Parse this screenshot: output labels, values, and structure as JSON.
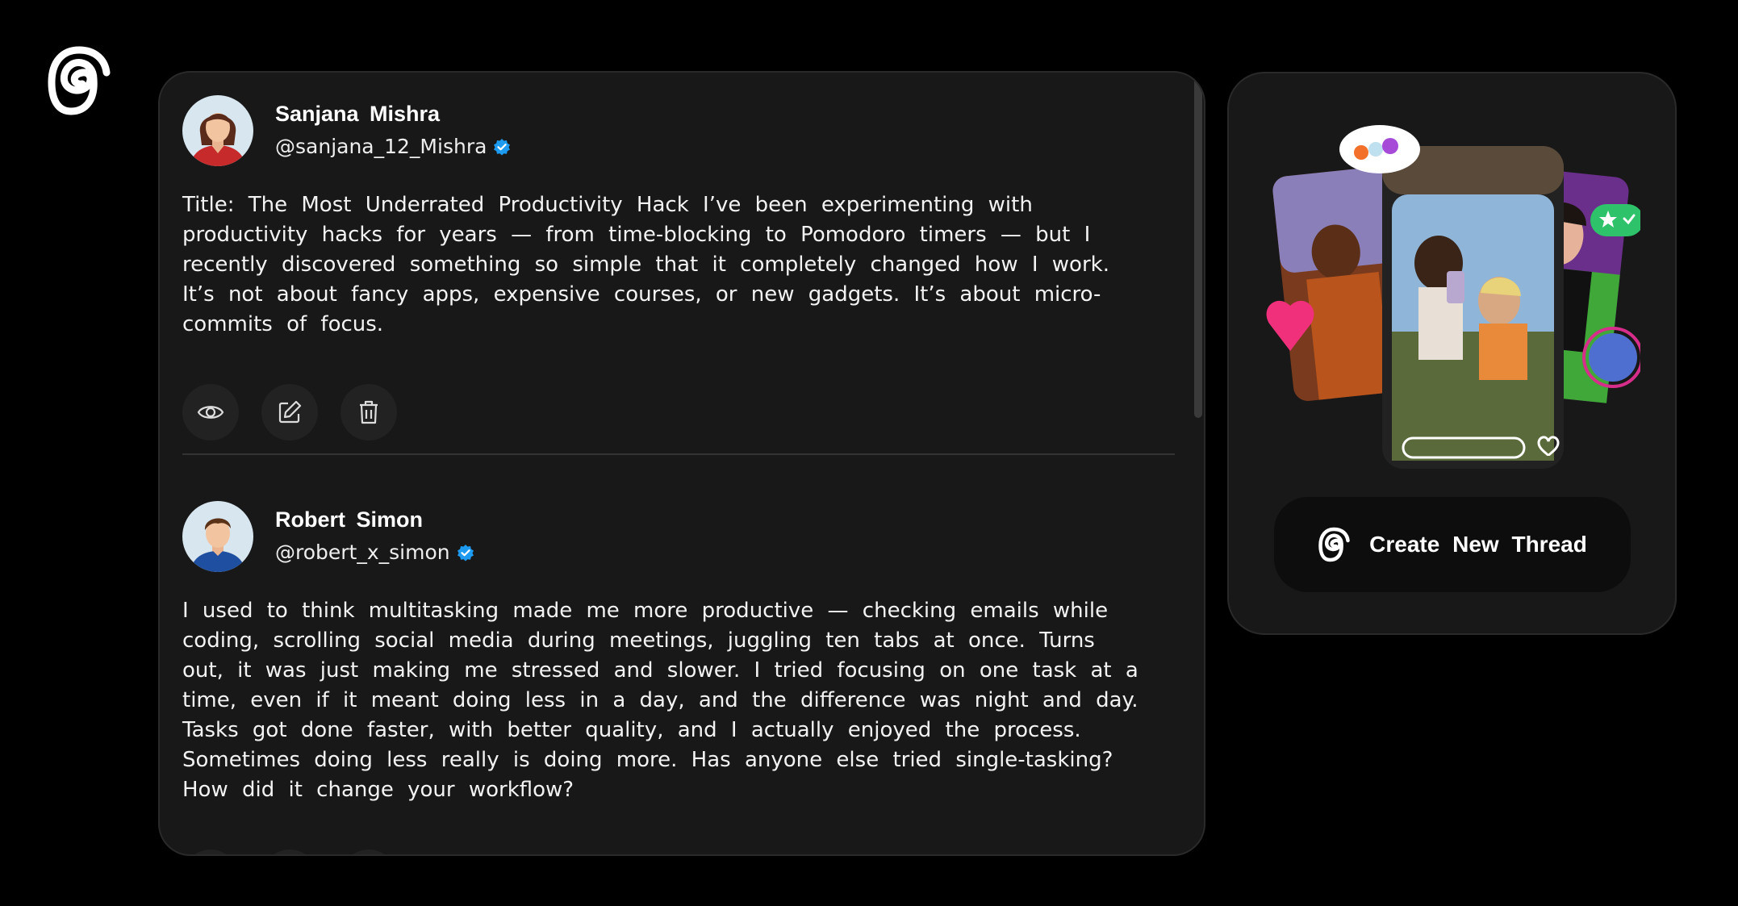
{
  "app": {
    "logo_icon": "threads-logo-icon"
  },
  "posts": [
    {
      "name": "Sanjana  Mishra",
      "handle": "@sanjana_12_Mishra",
      "verified": true,
      "avatar_icon": "female-avatar",
      "body": "Title: The Most Underrated Productivity Hack I’ve been experimenting with productivity hacks for years — from time-blocking to Pomodoro timers — but I recently discovered something so simple that it completely changed how I work. It’s not about fancy apps, expensive courses, or new gadgets. It’s about micro-commits of focus.",
      "actions": [
        "view-icon",
        "edit-icon",
        "delete-icon"
      ]
    },
    {
      "name": "Robert  Simon",
      "handle": "@robert_x_simon",
      "verified": true,
      "avatar_icon": "male-avatar",
      "body": "I used to think multitasking made me more productive — checking emails while coding, scrolling social media during meetings, juggling ten tabs at once. Turns out, it was just making me stressed and slower. I tried focusing on one task at a time, even if it meant doing less in a day, and the difference was night and day. Tasks got done faster, with better quality, and I actually enjoyed the process. Sometimes doing less really is doing more. Has anyone else tried single-tasking? How did it change your workflow?",
      "actions": [
        "view-icon",
        "edit-icon",
        "delete-icon"
      ]
    }
  ],
  "sidebar": {
    "create_button_label": "Create New Thread",
    "create_button_icon": "threads-logo-icon"
  },
  "colors": {
    "background": "#000000",
    "card": "#181818",
    "verified": "#1d9bf0"
  }
}
